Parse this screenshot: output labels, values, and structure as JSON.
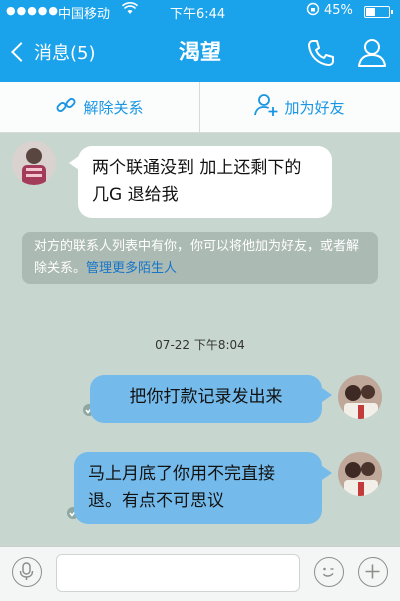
{
  "status_bar": {
    "signal": "●●●●●",
    "carrier": "中国移动",
    "time": "下午6:44",
    "battery_percent": "45%",
    "battery_level": 0.45
  },
  "nav": {
    "back_label": "消息(5)",
    "title": "渴望",
    "phone_icon": "phone-icon",
    "profile_icon": "profile-icon"
  },
  "actions": {
    "unlink_label": "解除关系",
    "add_friend_label": "加为好友"
  },
  "messages": {
    "first_incoming": "两个联通没到 加上还剩下的几G 退给我",
    "notice_text": "对方的联系人列表中有你，你可以将他加为好友，或者解除关系。",
    "notice_link": "管理更多陌生人",
    "timestamp": "07-22 下午8:04",
    "out_1": "把你打款记录发出来",
    "out_2": "马上月底了你用不完直接退。有点不可思议"
  },
  "input_bar": {
    "placeholder": "",
    "voice_icon": "microphone-icon",
    "emoji_icon": "emoji-icon",
    "plus_icon": "plus-icon"
  },
  "colors": {
    "header": "#1aa2ea",
    "background": "#c7d7d0",
    "outgoing_bubble": "#74bbec",
    "link": "#1675c9"
  }
}
